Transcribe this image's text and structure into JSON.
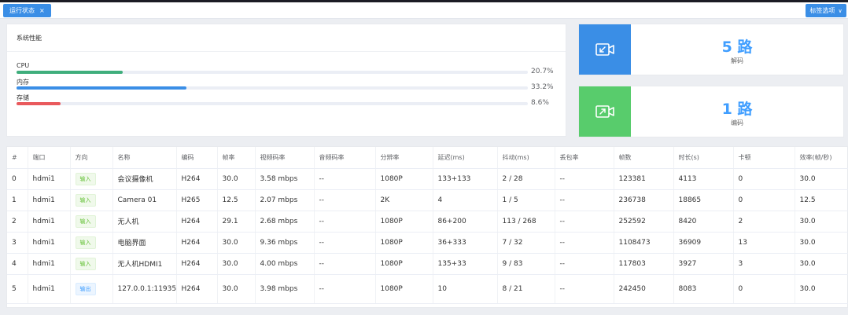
{
  "tabs": {
    "active_label": "运行状态",
    "close_symbol": "×",
    "ops_label": "标签选项",
    "ops_chevron": "∨"
  },
  "performance": {
    "title": "系统性能",
    "metrics": [
      {
        "label": "CPU",
        "percent_text": "20.7%",
        "fraction": 0.207,
        "color": "#3fae7c"
      },
      {
        "label": "内存",
        "percent_text": "33.2%",
        "fraction": 0.332,
        "color": "#3a8ee6"
      },
      {
        "label": "存储",
        "percent_text": "8.6%",
        "fraction": 0.086,
        "color": "#e9595c"
      }
    ]
  },
  "stats": [
    {
      "value": "5 路",
      "caption": "解码",
      "icon": "video-in-icon",
      "color": "#3a8ee6"
    },
    {
      "value": "1 路",
      "caption": "编码",
      "icon": "video-out-icon",
      "color": "#58cc6c"
    }
  ],
  "table": {
    "columns": [
      "#",
      "端口",
      "方向",
      "名称",
      "编码",
      "帧率",
      "视频码率",
      "音频码率",
      "分辨率",
      "延迟(ms)",
      "抖动(ms)",
      "丢包率",
      "帧数",
      "时长(s)",
      "卡顿",
      "效率(帧/秒)"
    ],
    "rows": [
      {
        "idx": "0",
        "port": "hdmi1",
        "dir": "输入",
        "dir_type": "in",
        "name": "会议摄像机",
        "codec": "H264",
        "fps": "30.0",
        "vbitrate": "3.58 mbps",
        "abitrate": "--",
        "res": "1080P",
        "latency": "133+133",
        "jitter": "2 / 28",
        "loss": "--",
        "frames": "123381",
        "duration": "4113",
        "stall": "0",
        "eff": "30.0"
      },
      {
        "idx": "1",
        "port": "hdmi1",
        "dir": "输入",
        "dir_type": "in",
        "name": "Camera 01",
        "codec": "H265",
        "fps": "12.5",
        "vbitrate": "2.07 mbps",
        "abitrate": "--",
        "res": "2K",
        "latency": "4",
        "jitter": "1 / 5",
        "loss": "--",
        "frames": "236738",
        "duration": "18865",
        "stall": "0",
        "eff": "12.5"
      },
      {
        "idx": "2",
        "port": "hdmi1",
        "dir": "输入",
        "dir_type": "in",
        "name": "无人机",
        "codec": "H264",
        "fps": "29.1",
        "vbitrate": "2.68 mbps",
        "abitrate": "--",
        "res": "1080P",
        "latency": "86+200",
        "jitter": "113 / 268",
        "loss": "--",
        "frames": "252592",
        "duration": "8420",
        "stall": "2",
        "eff": "30.0"
      },
      {
        "idx": "3",
        "port": "hdmi1",
        "dir": "输入",
        "dir_type": "in",
        "name": "电脑界面",
        "codec": "H264",
        "fps": "30.0",
        "vbitrate": "9.36 mbps",
        "abitrate": "--",
        "res": "1080P",
        "latency": "36+333",
        "jitter": "7 / 32",
        "loss": "--",
        "frames": "1108473",
        "duration": "36909",
        "stall": "13",
        "eff": "30.0"
      },
      {
        "idx": "4",
        "port": "hdmi1",
        "dir": "输入",
        "dir_type": "in",
        "name": "无人机HDMI1",
        "codec": "H264",
        "fps": "30.0",
        "vbitrate": "4.00 mbps",
        "abitrate": "--",
        "res": "1080P",
        "latency": "135+33",
        "jitter": "9 / 83",
        "loss": "--",
        "frames": "117803",
        "duration": "3927",
        "stall": "3",
        "eff": "30.0"
      },
      {
        "idx": "5",
        "port": "hdmi1",
        "dir": "输出",
        "dir_type": "out",
        "name": "127.0.0.1:11935",
        "codec": "H264",
        "fps": "30.0",
        "vbitrate": "3.98 mbps",
        "abitrate": "--",
        "res": "1080P",
        "latency": "10",
        "jitter": "8 / 21",
        "loss": "--",
        "frames": "242450",
        "duration": "8083",
        "stall": "0",
        "eff": "30.0"
      }
    ]
  }
}
